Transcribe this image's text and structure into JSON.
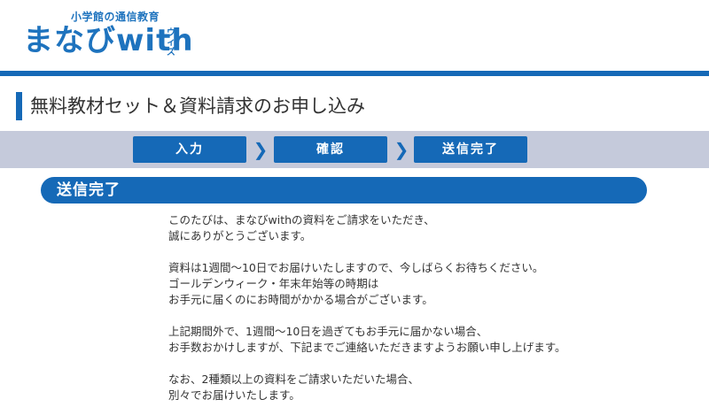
{
  "header": {
    "logo_sub": "小学館の通信教育",
    "logo_main": "まなびwith",
    "logo_tag": "ウィズ",
    "brand_color": "#1569b7"
  },
  "page": {
    "title": "無料教材セット＆資料請求のお申し込み"
  },
  "steps": {
    "items": [
      {
        "label": "入力"
      },
      {
        "label": "確認"
      },
      {
        "label": "送信完了"
      }
    ],
    "arrow_icon": "chevron-right-icon",
    "background": "#c5cadb"
  },
  "section": {
    "heading": "送信完了"
  },
  "content": {
    "paragraphs": [
      {
        "lines": [
          "このたびは、まなびwithの資料をご請求をいただき、",
          "誠にありがとうございます。"
        ]
      },
      {
        "lines": [
          "資料は1週間〜10日でお届けいたしますので、今しばらくお待ちください。",
          "ゴールデンウィーク・年末年始等の時期は",
          "お手元に届くのにお時間がかかる場合がございます。"
        ]
      },
      {
        "lines": [
          "上記期間外で、1週間〜10日を過ぎてもお手元に届かない場合、",
          "お手数おかけしますが、下記までご連絡いただきますようお願い申し上げます。"
        ]
      },
      {
        "lines": [
          "なお、2種類以上の資料をご請求いただいた場合、",
          "別々でお届けいたします。"
        ]
      }
    ]
  }
}
